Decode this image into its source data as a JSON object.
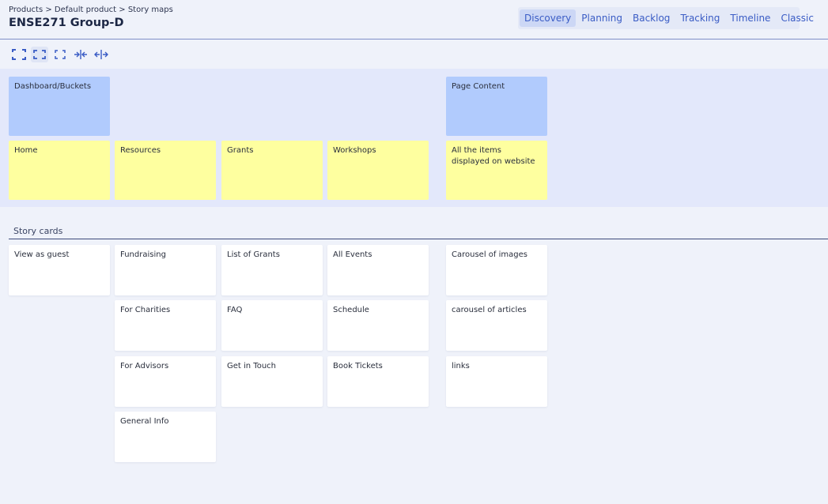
{
  "breadcrumb": "Products > Default product > Story maps",
  "title": "ENSE271 Group-D",
  "tabs": [
    "Discovery",
    "Planning",
    "Backlog",
    "Tracking",
    "Timeline",
    "Classic"
  ],
  "active_tab": "Discovery",
  "toolbar": {
    "icons": [
      "expand-all-icon",
      "expand-icon",
      "collapse-icon",
      "narrow-columns-icon",
      "widen-columns-icon"
    ]
  },
  "epics": [
    "Dashboard/Buckets",
    "Page Content"
  ],
  "features": [
    "Home",
    "Resources",
    "Grants",
    "Workshops",
    "All the items displayed on website"
  ],
  "story_section_label": "Story cards",
  "stories": {
    "home": [
      "View as guest"
    ],
    "resources": [
      "Fundraising",
      "For Charities",
      "For Advisors",
      "General Info"
    ],
    "grants": [
      "List of Grants",
      "FAQ",
      "Get in Touch"
    ],
    "workshops": [
      "All Events",
      "Schedule",
      "Book Tickets"
    ],
    "page_content": [
      "Carousel of images",
      "carousel of articles",
      "links"
    ]
  },
  "colors": {
    "background": "#eff2fa",
    "map_band": "#e3e8fb",
    "epic_card": "#b1cbfd",
    "feature_card": "#feff9f",
    "story_card": "#ffffff",
    "accent": "#3a5cc5"
  }
}
